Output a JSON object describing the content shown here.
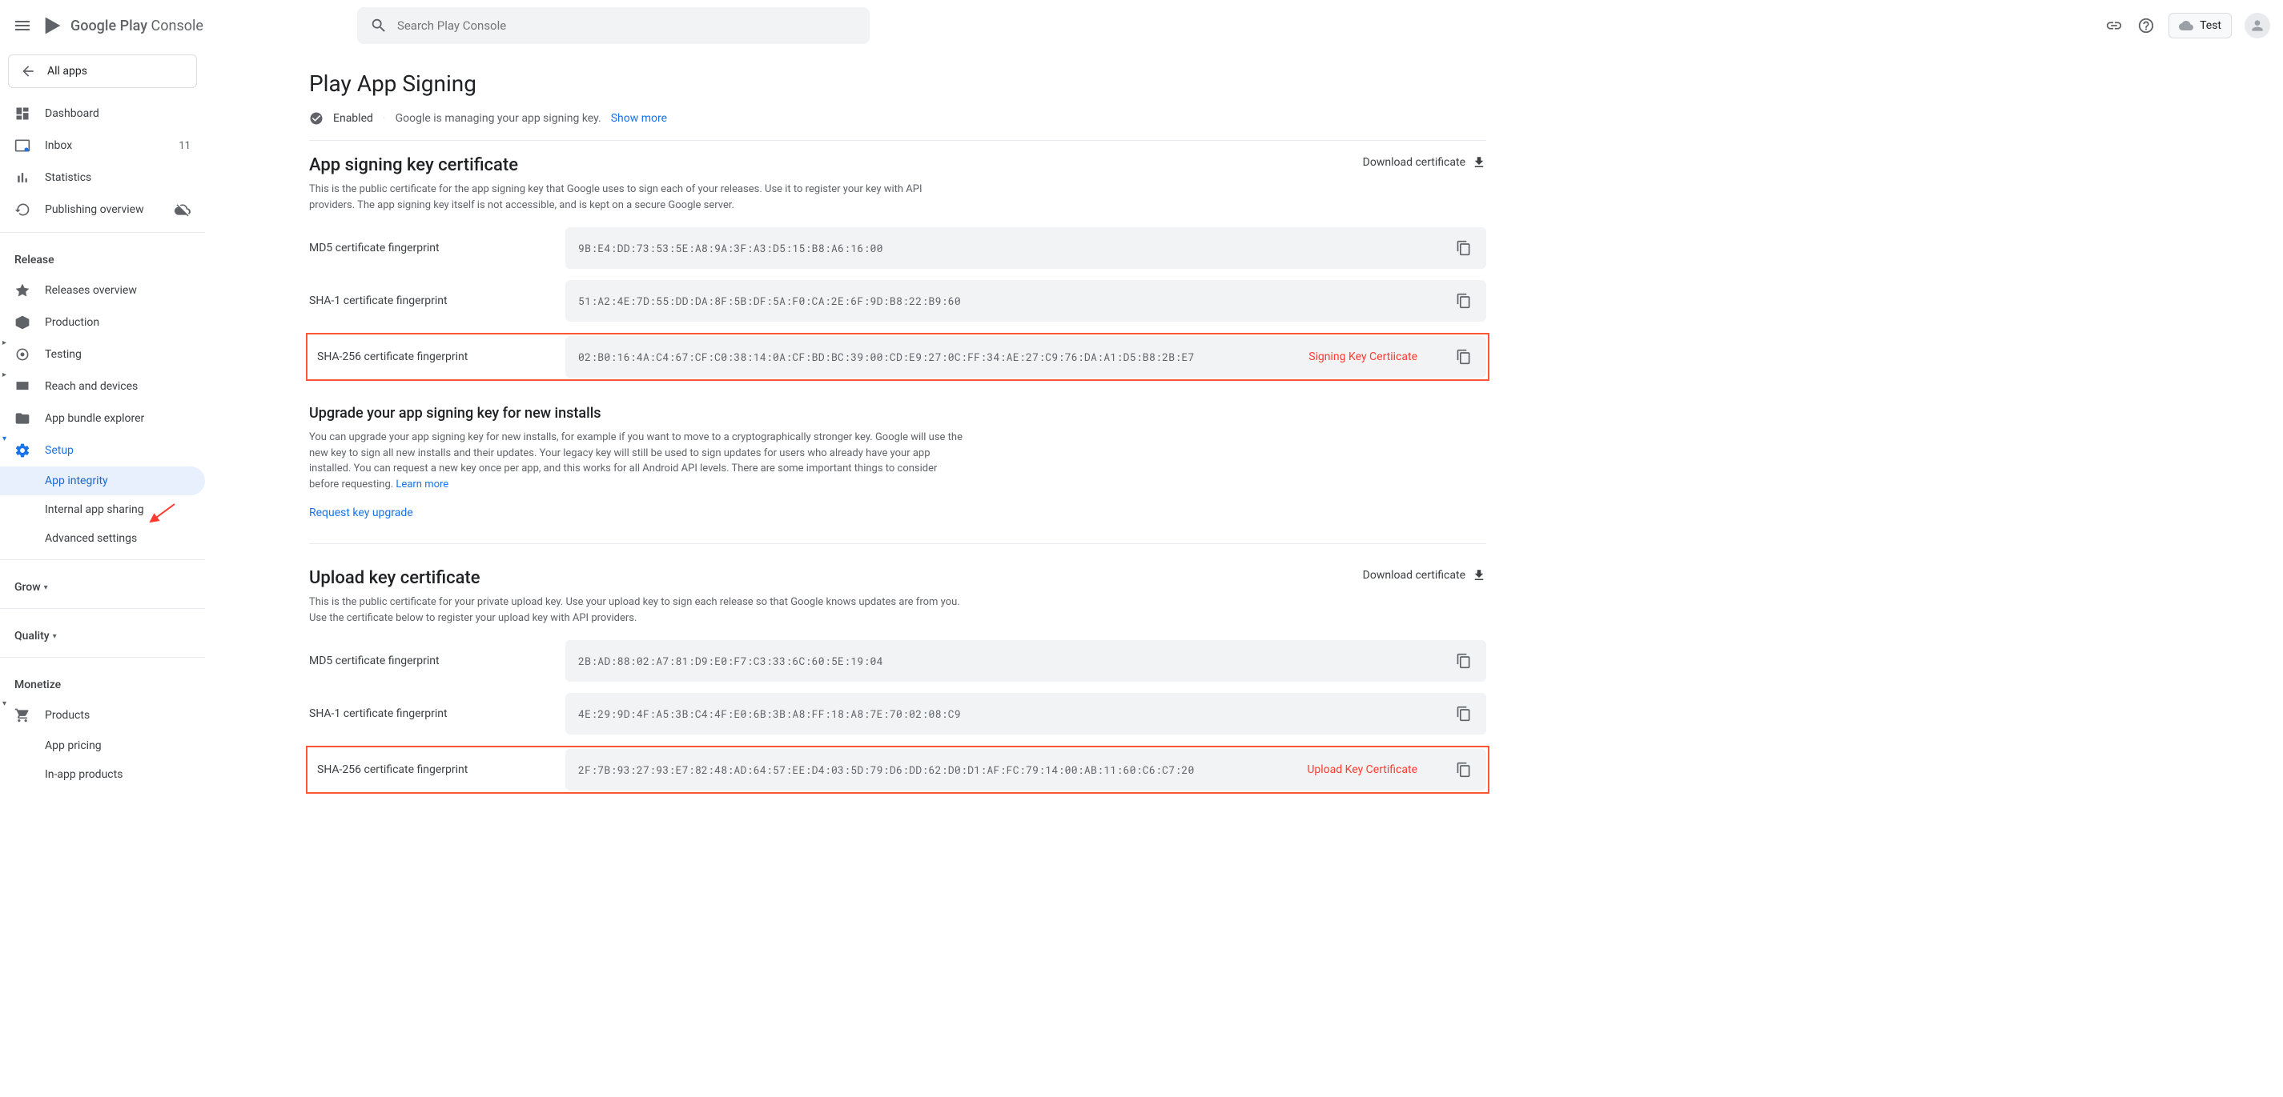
{
  "header": {
    "logo_prefix": "Google Play",
    "logo_suffix": " Console",
    "search_placeholder": "Search Play Console",
    "profile_label": "Test"
  },
  "sidebar": {
    "back": "All apps",
    "items": [
      {
        "label": "Dashboard"
      },
      {
        "label": "Inbox",
        "badge": "11"
      },
      {
        "label": "Statistics"
      },
      {
        "label": "Publishing overview"
      }
    ],
    "release_header": "Release",
    "release_items": [
      {
        "label": "Releases overview"
      },
      {
        "label": "Production"
      },
      {
        "label": "Testing"
      },
      {
        "label": "Reach and devices"
      },
      {
        "label": "App bundle explorer"
      },
      {
        "label": "Setup"
      }
    ],
    "setup_subitems": [
      {
        "label": "App integrity"
      },
      {
        "label": "Internal app sharing"
      },
      {
        "label": "Advanced settings"
      }
    ],
    "grow_header": "Grow",
    "quality_header": "Quality",
    "monetize_header": "Monetize",
    "monetize_items": [
      {
        "label": "Products"
      }
    ],
    "monetize_subitems": [
      {
        "label": "App pricing"
      },
      {
        "label": "In-app products"
      }
    ]
  },
  "page": {
    "title": "Play App Signing",
    "status_enabled": "Enabled",
    "status_text": "Google is managing your app signing key.",
    "show_more": "Show more",
    "signing_section": {
      "title": "App signing key certificate",
      "desc": "This is the public certificate for the app signing key that Google uses to sign each of your releases. Use it to register your key with API providers. The app signing key itself is not accessible, and is kept on a secure Google server.",
      "download": "Download certificate",
      "fingerprints": [
        {
          "label": "MD5 certificate fingerprint",
          "value": "9B:E4:DD:73:53:5E:A8:9A:3F:A3:D5:15:B8:A6:16:00"
        },
        {
          "label": "SHA-1 certificate fingerprint",
          "value": "51:A2:4E:7D:55:DD:DA:8F:5B:DF:5A:F0:CA:2E:6F:9D:B8:22:B9:60"
        },
        {
          "label": "SHA-256 certificate fingerprint",
          "value": "02:B0:16:4A:C4:67:CF:C0:38:14:0A:CF:BD:BC:39:00:CD:E9:27:0C:FF:34:AE:27:C9:76:DA:A1:D5:B8:2B:E7",
          "annotation": "Signing Key Certiicate"
        }
      ]
    },
    "upgrade_section": {
      "title": "Upgrade your app signing key for new installs",
      "desc": "You can upgrade your app signing key for new installs, for example if you want to move to a cryptographically stronger key. Google will use the new key to sign all new installs and their updates. Your legacy key will still be used to sign updates for users who already have your app installed. You can request a new key once per app, and this works for all Android API levels. There are some important things to consider before requesting.",
      "learn_more": "Learn more",
      "request": "Request key upgrade"
    },
    "upload_section": {
      "title": "Upload key certificate",
      "desc": "This is the public certificate for your private upload key. Use your upload key to sign each release so that Google knows updates are from you. Use the certificate below to register your upload key with API providers.",
      "download": "Download certificate",
      "fingerprints": [
        {
          "label": "MD5 certificate fingerprint",
          "value": "2B:AD:88:02:A7:81:D9:E0:F7:C3:33:6C:60:5E:19:04"
        },
        {
          "label": "SHA-1 certificate fingerprint",
          "value": "4E:29:9D:4F:A5:3B:C4:4F:E0:6B:3B:A8:FF:18:A8:7E:70:02:08:C9"
        },
        {
          "label": "SHA-256 certificate fingerprint",
          "value": "2F:7B:93:27:93:E7:82:48:AD:64:57:EE:D4:03:5D:79:D6:DD:62:D0:D1:AF:FC:79:14:00:AB:11:60:C6:C7:20",
          "annotation": "Upload Key Certificate"
        }
      ]
    }
  }
}
